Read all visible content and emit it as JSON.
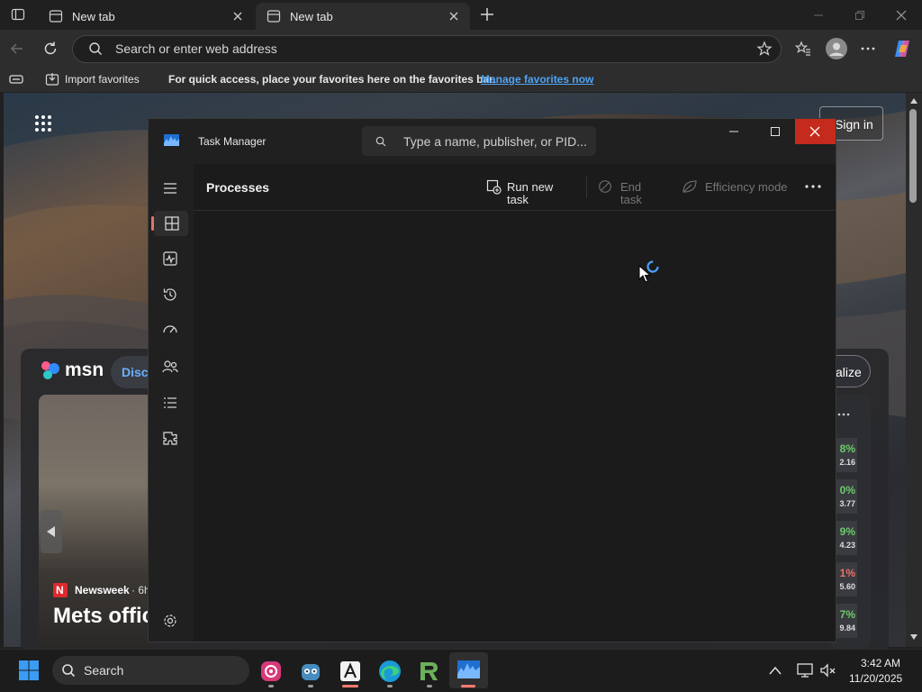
{
  "browser": {
    "tabs": [
      {
        "label": "New tab",
        "active": false
      },
      {
        "label": "New tab",
        "active": true
      }
    ],
    "address_placeholder": "Search or enter web address",
    "favorites_bar": {
      "import_label": "Import favorites",
      "prompt": "For quick access, place your favorites here on the favorites bar.",
      "link": "Manage favorites now"
    }
  },
  "newtab_page": {
    "sign_in_label": "Sign in",
    "msn_logo_text": "msn",
    "discover_label": "Disco",
    "personalize_label": "alize",
    "news_source": "Newsweek",
    "news_age": "· 6h",
    "headline": "Mets offic",
    "stocks": [
      {
        "pct": "8%",
        "price": "2.16",
        "color": "#6ccb6c"
      },
      {
        "pct": "0%",
        "price": "3.77",
        "color": "#6ccb6c"
      },
      {
        "pct": "9%",
        "price": "4.23",
        "color": "#6ccb6c"
      },
      {
        "pct": "1%",
        "price": "5.60",
        "color": "#e8706a"
      },
      {
        "pct": "7%",
        "price": "9.84",
        "color": "#6ccb6c"
      }
    ]
  },
  "task_manager": {
    "title": "Task Manager",
    "search_placeholder": "Type a name, publisher, or PID...",
    "page_title": "Processes",
    "commands": {
      "run_new_task": "Run new task",
      "end_task": "End task",
      "efficiency_mode": "Efficiency mode"
    },
    "nav": [
      "Processes",
      "Performance",
      "App history",
      "Startup apps",
      "Users",
      "Details",
      "Services"
    ],
    "loading": true
  },
  "taskbar": {
    "search_label": "Search",
    "time": "3:42 AM",
    "date": "11/20/2025",
    "apps": [
      "davinci-resolve-icon",
      "godot-icon",
      "affinity-icon",
      "edge-icon",
      "rider-icon",
      "task-manager-icon"
    ]
  },
  "colors": {
    "accent": "#0078d4",
    "close_red": "#c42b1c",
    "link": "#4ea4f5",
    "nav_indicator": "#e8706a"
  }
}
